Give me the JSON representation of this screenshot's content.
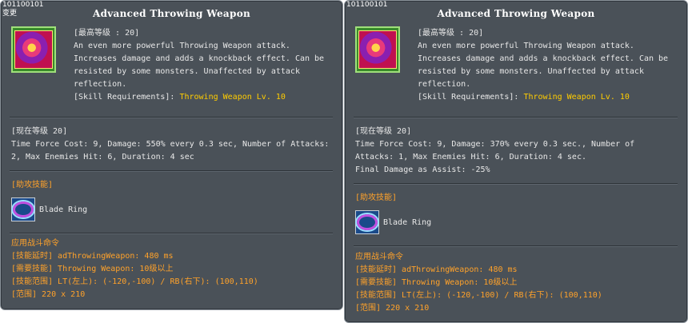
{
  "left": {
    "skill_id": "101100101",
    "tag": "变更",
    "title": "Advanced Throwing Weapon",
    "max_level": "[最高等级 : 20]",
    "description": "An even more powerful Throwing Weapon attack.\nIncreases damage and adds a knockback effect. Can be\nresisted by some monsters. Unaffected by attack\nreflection.",
    "req_label": "[Skill Requirements]: ",
    "req_value": "Throwing Weapon Lv. 10",
    "current_level": "[现在等级 20]",
    "current_desc": "Time Force Cost: 9, Damage: 550% every 0.3 sec, Number of Attacks:\n2, Max Enemies Hit: 6, Duration: 4 sec",
    "assist_header": "[助攻技能]",
    "assist_skill": "Blade Ring",
    "cmd_header": "应用战斗命令",
    "cmd_lines": [
      "[技能延时] adThrowingWeapon: 480 ms",
      "[需要技能] Throwing Weapon: 10级以上",
      "[技能范围] LT(左上): (-120,-100) / RB(右下): (100,110)",
      "[范围] 220 x 210"
    ]
  },
  "right": {
    "skill_id": "101100101",
    "title": "Advanced Throwing Weapon",
    "max_level": "[最高等级 : 20]",
    "description": "An even more powerful Throwing Weapon attack.\nIncreases damage and adds a knockback effect. Can be\nresisted by some monsters. Unaffected by attack\nreflection.",
    "req_label": "[Skill Requirements]: ",
    "req_value": "Throwing Weapon Lv. 10",
    "current_level": "[现在等级 20]",
    "current_desc": "Time Force Cost: 9, Damage: 370% every 0.3 sec., Number of\nAttacks: 1, Max Enemies Hit: 6, Duration: 4 sec.\nFinal Damage as Assist: -25%",
    "assist_header": "[助攻技能]",
    "assist_skill": "Blade Ring",
    "cmd_header": "应用战斗命令",
    "cmd_lines": [
      "[技能延时] adThrowingWeapon: 480 ms",
      "[需要技能] Throwing Weapon: 10级以上",
      "[技能范围] LT(左上): (-120,-100) / RB(右下): (100,110)",
      "[范围] 220 x 210"
    ]
  },
  "colors": {
    "panel_bg": "#4a5158",
    "req_yellow": "#ffcc00",
    "command_orange": "#ffa22a",
    "icon_frame": "#9fe07a"
  }
}
